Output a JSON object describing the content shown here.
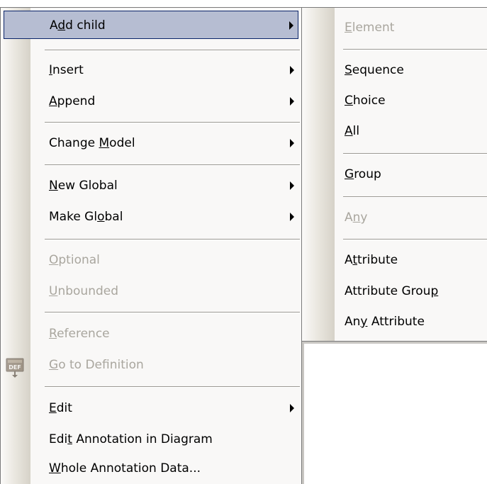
{
  "main_menu": {
    "items": [
      {
        "pre": "A",
        "key": "d",
        "post": "d child",
        "disabled": false,
        "submenu": true,
        "highlight": true
      },
      {
        "pre": "",
        "key": "I",
        "post": "nsert",
        "disabled": false,
        "submenu": true
      },
      {
        "pre": "",
        "key": "A",
        "post": "ppend",
        "disabled": false,
        "submenu": true
      },
      {
        "pre": "Change ",
        "key": "M",
        "post": "odel",
        "disabled": false,
        "submenu": true
      },
      {
        "pre": "",
        "key": "N",
        "post": "ew Global",
        "disabled": false,
        "submenu": true
      },
      {
        "pre": "Make Gl",
        "key": "o",
        "post": "bal",
        "disabled": false,
        "submenu": true
      },
      {
        "pre": "",
        "key": "O",
        "post": "ptional",
        "disabled": true,
        "submenu": false
      },
      {
        "pre": "",
        "key": "U",
        "post": "nbounded",
        "disabled": true,
        "submenu": false
      },
      {
        "pre": "",
        "key": "R",
        "post": "eference",
        "disabled": true,
        "submenu": false
      },
      {
        "pre": "",
        "key": "G",
        "post": "o to Definition",
        "disabled": true,
        "submenu": false,
        "icon": "def-icon"
      },
      {
        "pre": "",
        "key": "E",
        "post": "dit",
        "disabled": false,
        "submenu": true
      },
      {
        "pre": "Edi",
        "key": "t",
        "post": " Annotation in Diagram",
        "disabled": false,
        "submenu": false
      },
      {
        "pre": "",
        "key": "W",
        "post": "hole Annotation Data...",
        "disabled": false,
        "submenu": false
      }
    ]
  },
  "sub_menu": {
    "items": [
      {
        "pre": "",
        "key": "E",
        "post": "lement",
        "disabled": true
      },
      {
        "pre": "",
        "key": "S",
        "post": "equence",
        "disabled": false
      },
      {
        "pre": "",
        "key": "C",
        "post": "hoice",
        "disabled": false
      },
      {
        "pre": "",
        "key": "A",
        "post": "ll",
        "disabled": false
      },
      {
        "pre": "",
        "key": "G",
        "post": "roup",
        "disabled": false
      },
      {
        "pre": "A",
        "key": "n",
        "post": "y",
        "disabled": true
      },
      {
        "pre": "A",
        "key": "t",
        "post": "tribute",
        "disabled": false
      },
      {
        "pre": "Attribute Grou",
        "key": "p",
        "post": "",
        "disabled": false
      },
      {
        "pre": "An",
        "key": "y",
        "post": " Attribute",
        "disabled": false
      }
    ]
  },
  "icons": {
    "def_icon_label": "DEF"
  },
  "colors": {
    "highlight_bg": "#b6bdd2",
    "highlight_border": "#0a246a",
    "disabled_text": "#a9a69e"
  }
}
